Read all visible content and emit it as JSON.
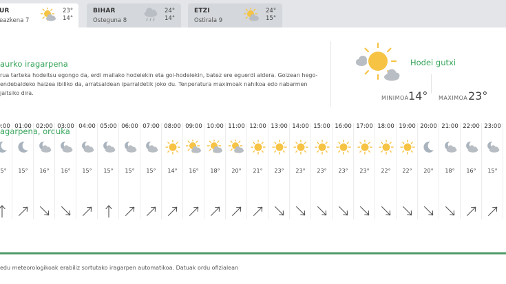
{
  "tabs": [
    {
      "name": "UR",
      "date": "eazkena 7",
      "icon": "sun-cloud-icon",
      "max": "23°",
      "min": "14°",
      "active": true
    },
    {
      "name": "BIHAR",
      "date": "Osteguna 8",
      "icon": "cloud-rain-icon",
      "max": "24°",
      "min": "14°",
      "active": false
    },
    {
      "name": "ETZI",
      "date": "Ostirala 9",
      "icon": "sun-cloud-icon",
      "max": "24°",
      "min": "15°",
      "active": false
    }
  ],
  "today": {
    "title": "aurko iragarpena",
    "lines": [
      "rua tarteka hodeitsu egongo da, erdi mailako hodeiekin eta goi-hodeiekin, batez ere eguerdi aldera. Goizean hego-",
      "endebaldeko haizea ibiliko da, arratsaldean iparraldetik joko du. Tenperatura maximoak nahikoa edo nabarmen jaitsiko dira."
    ],
    "condition": "Hodei gutxi",
    "min_label": "MINIMOA",
    "min_value": "14°",
    "max_label": "MAXIMOA",
    "max_value": "23°"
  },
  "hourly": {
    "title": "agarpena, orduka",
    "hours": [
      {
        "time": "00:00",
        "icon": "moon-icon",
        "temp": "15°",
        "dir": "N"
      },
      {
        "time": "01:00",
        "icon": "moon-icon",
        "temp": "15°",
        "dir": "NE"
      },
      {
        "time": "02:00",
        "icon": "moon-cloud-icon",
        "temp": "16°",
        "dir": "SE"
      },
      {
        "time": "03:00",
        "icon": "moon-cloud-icon",
        "temp": "16°",
        "dir": "SE"
      },
      {
        "time": "04:00",
        "icon": "moon-cloud-icon",
        "temp": "15°",
        "dir": "NE"
      },
      {
        "time": "05:00",
        "icon": "moon-cloud-icon",
        "temp": "15°",
        "dir": "N"
      },
      {
        "time": "06:00",
        "icon": "moon-cloud-icon",
        "temp": "15°",
        "dir": "NE"
      },
      {
        "time": "07:00",
        "icon": "moon-cloud-icon",
        "temp": "15°",
        "dir": "NE"
      },
      {
        "time": "08:00",
        "icon": "sun-icon",
        "temp": "14°",
        "dir": "NE"
      },
      {
        "time": "09:00",
        "icon": "sun-cloud-icon",
        "temp": "16°",
        "dir": "NE"
      },
      {
        "time": "10:00",
        "icon": "sun-cloud-icon",
        "temp": "18°",
        "dir": "NE"
      },
      {
        "time": "11:00",
        "icon": "sun-cloud-icon",
        "temp": "20°",
        "dir": "NE"
      },
      {
        "time": "12:00",
        "icon": "sun-icon",
        "temp": "21°",
        "dir": "NE"
      },
      {
        "time": "13:00",
        "icon": "sun-icon",
        "temp": "23°",
        "dir": "SE"
      },
      {
        "time": "14:00",
        "icon": "sun-icon",
        "temp": "23°",
        "dir": "SE"
      },
      {
        "time": "15:00",
        "icon": "sun-icon",
        "temp": "23°",
        "dir": "SE"
      },
      {
        "time": "16:00",
        "icon": "sun-icon",
        "temp": "23°",
        "dir": "SE"
      },
      {
        "time": "17:00",
        "icon": "sun-icon",
        "temp": "23°",
        "dir": "SE"
      },
      {
        "time": "18:00",
        "icon": "sun-icon",
        "temp": "22°",
        "dir": "SE"
      },
      {
        "time": "19:00",
        "icon": "sun-icon",
        "temp": "22°",
        "dir": "SE"
      },
      {
        "time": "20:00",
        "icon": "moon-icon",
        "temp": "20°",
        "dir": "SE"
      },
      {
        "time": "21:00",
        "icon": "moon-cloud-icon",
        "temp": "18°",
        "dir": "SE"
      },
      {
        "time": "22:00",
        "icon": "moon-cloud-icon",
        "temp": "16°",
        "dir": "NE"
      },
      {
        "time": "23:00",
        "icon": "moon-cloud-icon",
        "temp": "15°",
        "dir": "NE"
      }
    ]
  },
  "footer": "edu meteorologikoak erabiliz sortutako iragarpen automatikoa. Datuak ordu ofizialean",
  "colors": {
    "accent": "#36a45a",
    "sun": "#f6c344",
    "moon": "#a9b4be",
    "cloud": "#b9bec4",
    "bar": "#4f9b68"
  }
}
